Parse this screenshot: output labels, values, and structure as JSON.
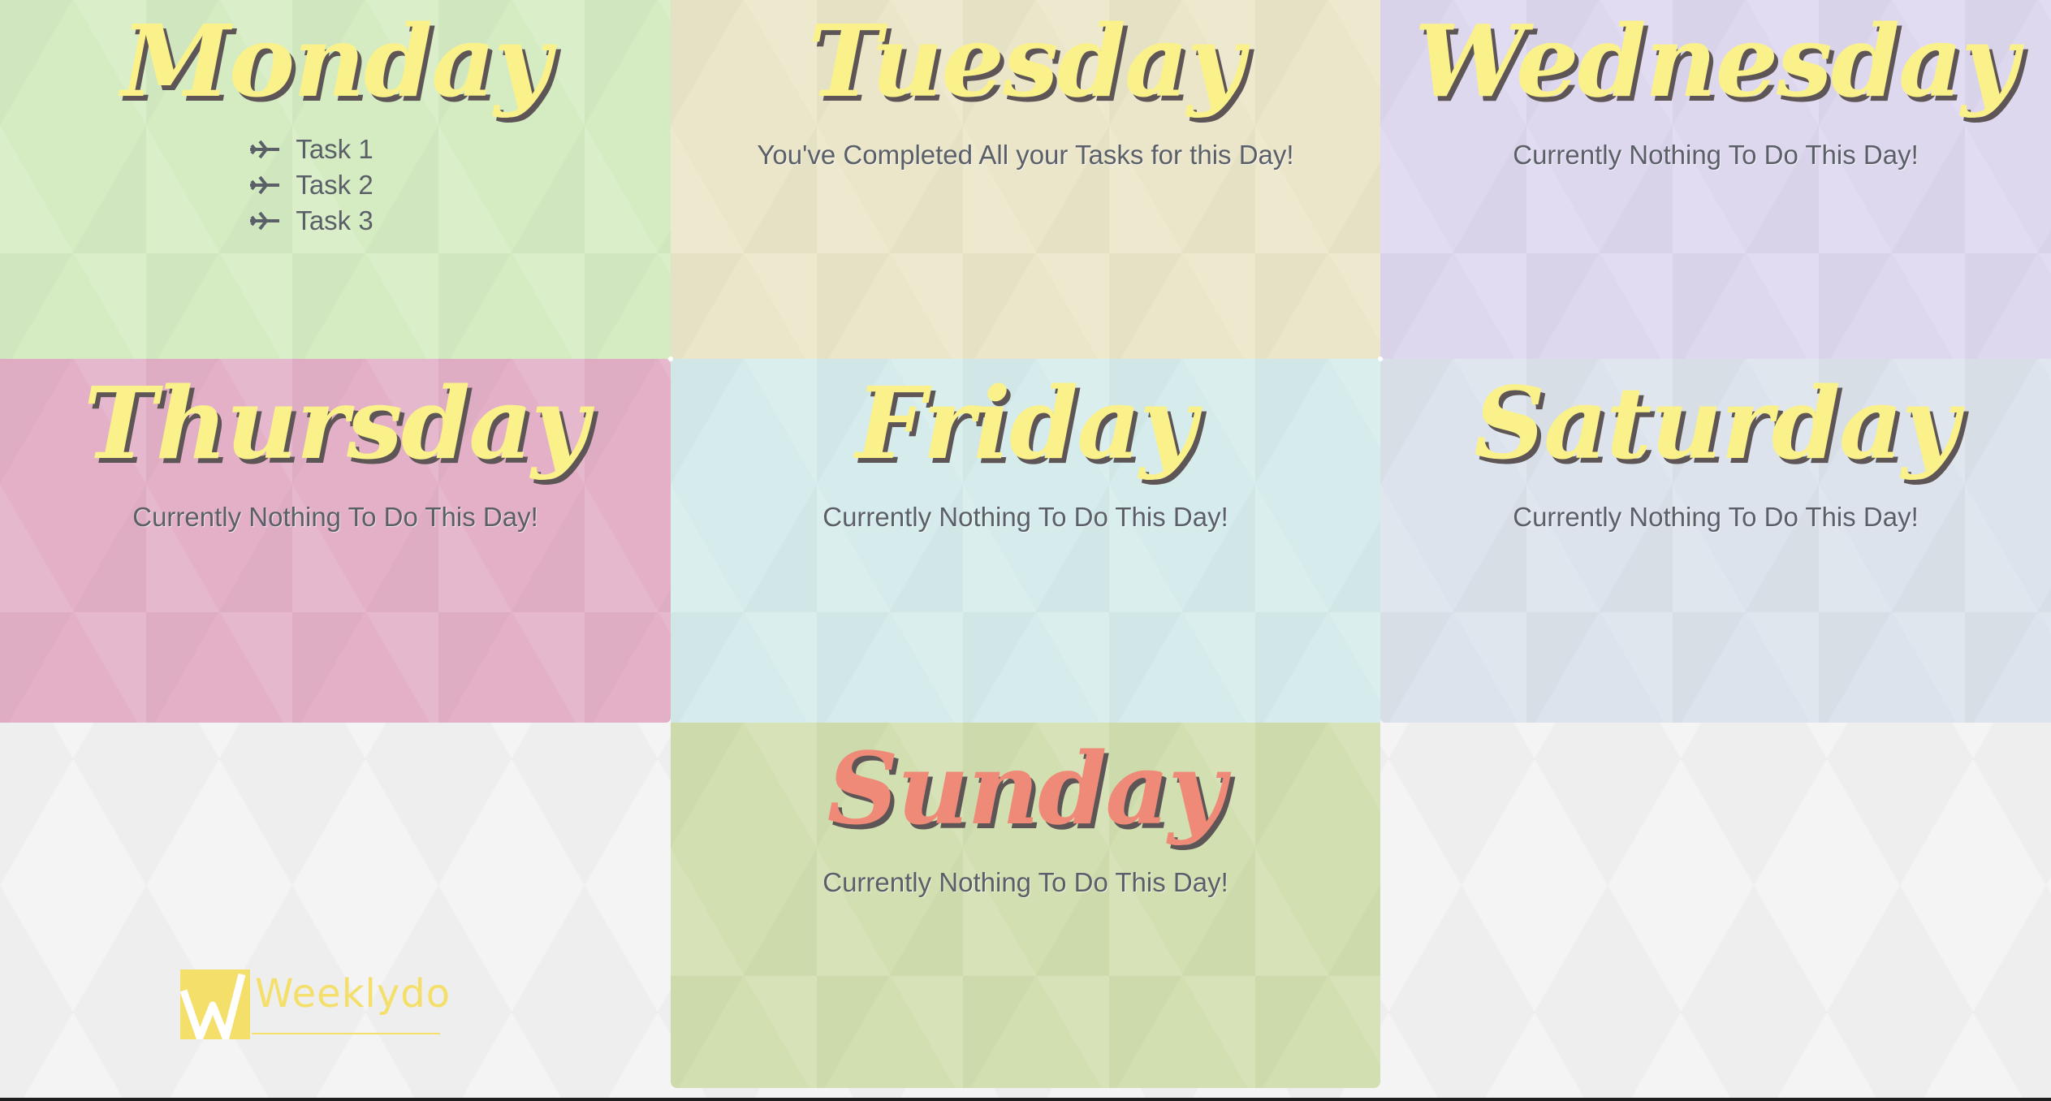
{
  "days": [
    {
      "name": "Monday",
      "tasks": [
        "Task 1",
        "Task 2",
        "Task 3"
      ],
      "message": "",
      "color": "#d5ecc3"
    },
    {
      "name": "Tuesday",
      "tasks": [],
      "message": "You've Completed All your Tasks for this Day!",
      "color": "#ebe6ca"
    },
    {
      "name": "Wednesday",
      "tasks": [],
      "message": "Currently Nothing To Do This Day!",
      "color": "#ded8ef"
    },
    {
      "name": "Thursday",
      "tasks": [],
      "message": "Currently Nothing To Do This Day!",
      "color": "#e3b0c8"
    },
    {
      "name": "Friday",
      "tasks": [],
      "message": "Currently Nothing To Do This Day!",
      "color": "#d6ecec"
    },
    {
      "name": "Saturday",
      "tasks": [],
      "message": "Currently Nothing To Do This Day!",
      "color": "#dce3ec"
    },
    {
      "name": "Sunday",
      "tasks": [],
      "message": "Currently Nothing To Do This Day!",
      "color": "#d2dfb0"
    }
  ],
  "colors": {
    "title": "#faf18a",
    "title_today": "#ef8a78",
    "title_shadow": "#5e5656",
    "text": "#5b5f68",
    "logo": "#f4df6a"
  },
  "logo": {
    "text": "Weeklydo",
    "icon": "weeklydo-logo-icon"
  },
  "icons": {
    "task_bullet": "airplane-icon"
  }
}
